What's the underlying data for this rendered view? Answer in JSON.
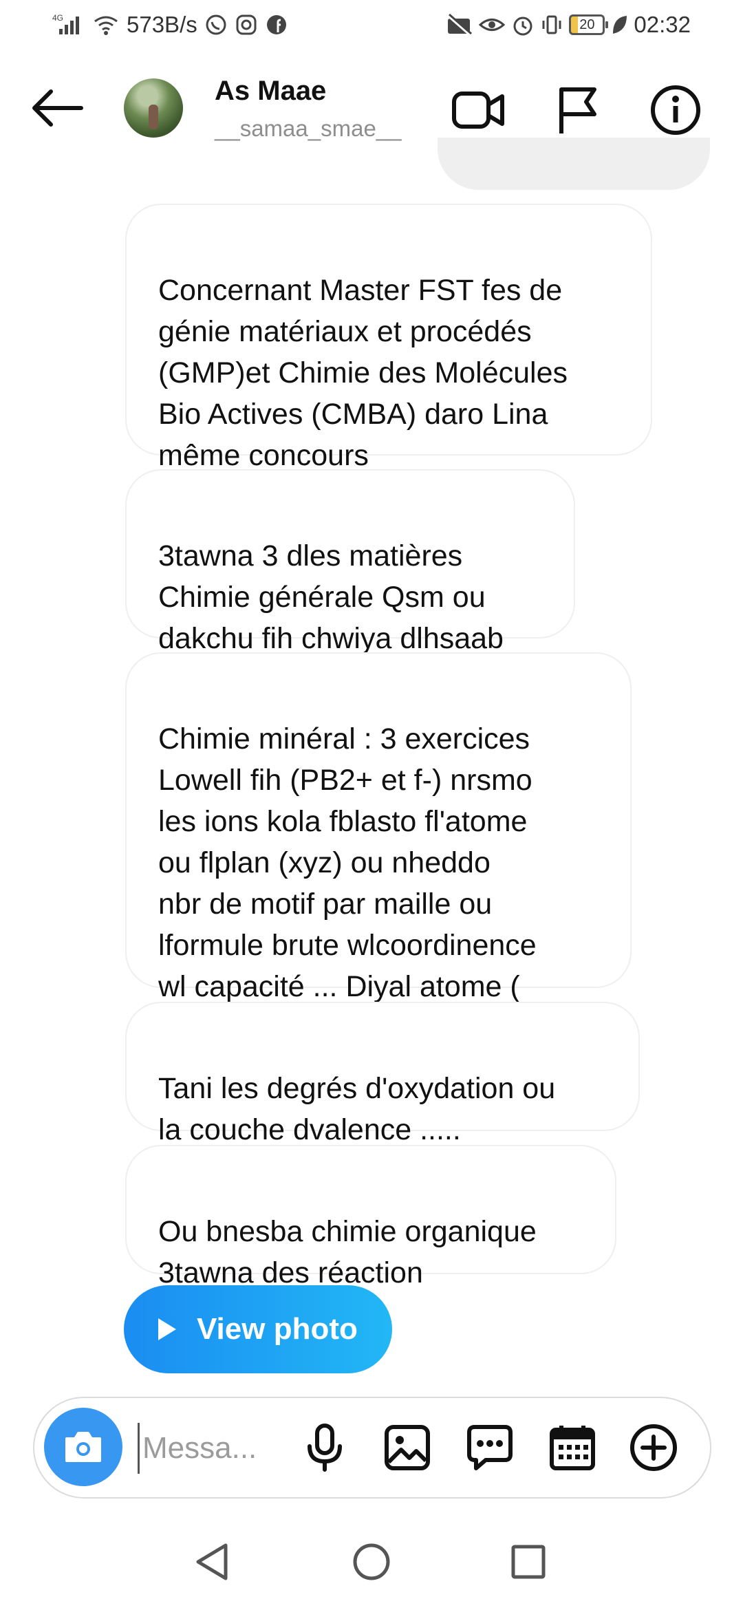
{
  "status_bar": {
    "network": "4G",
    "speed": "573B/s",
    "battery": "20",
    "time": "02:32"
  },
  "header": {
    "name": "As Maae",
    "username": "__samaa_smae__",
    "icons": [
      "back-arrow-icon",
      "video-call-icon",
      "flag-icon",
      "info-icon"
    ]
  },
  "messages": [
    {
      "text": "Concernant Master  FST fes de\ngénie matériaux et procédés\n(GMP)et Chimie des Molécules\nBio Actives (CMBA)  daro Lina\nmême concours"
    },
    {
      "text": "3tawna 3 dles matières\nChimie générale Qsm ou\ndakchu fih chwiya dlhsaab"
    },
    {
      "text": "Chimie minéral : 3 exercices\nLowell fih  (PB2+ et f-) nrsmo\nles ions kola fblasto fl'atome\nou flplan (xyz) ou nheddo\nnbr de motif par  maille ou\nlformule brute wlcoordinence\nwl capacité ... Diyal atome ("
    },
    {
      "text": "Tani les degrés d'oxydation ou\nla couche dvalence ....."
    },
    {
      "text": "Ou bnesba chimie organique\n3tawna des réaction"
    }
  ],
  "view_photo_label": "View photo",
  "composer": {
    "placeholder": "Messa...",
    "icons": [
      "camera-icon",
      "microphone-icon",
      "gallery-icon",
      "sticker-icon",
      "calendar-icon",
      "plus-icon"
    ]
  },
  "colors": {
    "accent_blue": "#3897f0",
    "bubble_border": "#efefef",
    "secondary_text": "#8e8e8e"
  }
}
